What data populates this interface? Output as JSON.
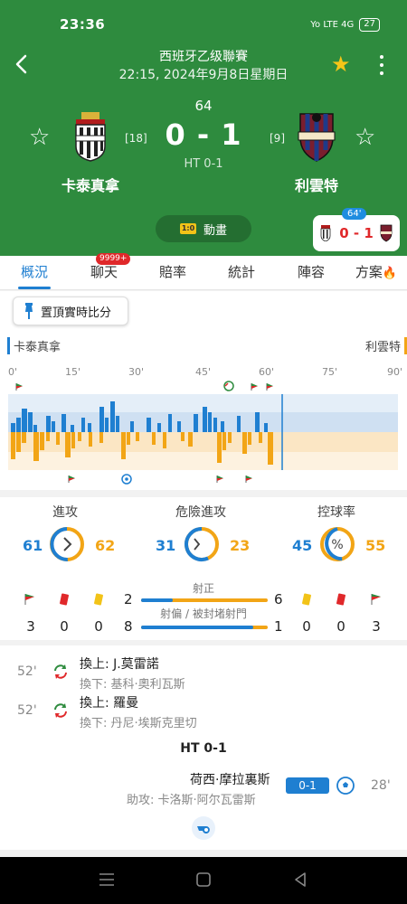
{
  "status_bar": {
    "time": "23:36",
    "network": "Yo LTE 4G",
    "battery": "27"
  },
  "header": {
    "league": "西班牙乙级聯賽",
    "datetime": "22:15, 2024年9月8日星期日",
    "minute": "64",
    "score": "0 - 1",
    "half_time": "HT 0-1",
    "home": {
      "name": "卡泰真拿",
      "rank": "[18]"
    },
    "away": {
      "name": "利雲特",
      "rank": "[9]"
    },
    "animation_label": "動畫",
    "animation_icon_text": "1:0",
    "mini_card": {
      "minute": "64'",
      "score": "0 - 1"
    },
    "colors": {
      "header_bg": "#2e8b3e",
      "star": "#f5c518"
    }
  },
  "tabs": [
    {
      "label": "概況",
      "active": true
    },
    {
      "label": "聊天",
      "badge": "9999+"
    },
    {
      "label": "賠率"
    },
    {
      "label": "統計"
    },
    {
      "label": "陣容"
    },
    {
      "label": "方案"
    }
  ],
  "pin_button": {
    "label": "置頂實時比分"
  },
  "momentum": {
    "home_label": "卡泰真拿",
    "away_label": "利雲特",
    "axis": [
      "0'",
      "15'",
      "30'",
      "45'",
      "60'",
      "75'",
      "90'"
    ]
  },
  "stats": {
    "attack": {
      "label": "進攻",
      "home": "61",
      "away": "62"
    },
    "danger": {
      "label": "危險進攻",
      "home": "31",
      "away": "23"
    },
    "possession": {
      "label": "控球率",
      "home": "45",
      "away": "55"
    },
    "shots_on_target": {
      "label": "射正",
      "home": "2",
      "away": "6"
    },
    "shots_off": {
      "label": "射偏 / 被封堵射門",
      "home": "8",
      "away": "1"
    },
    "home_cards": {
      "corners": "3",
      "red": "0",
      "yellow": "0"
    },
    "away_cards": {
      "yellow": "0",
      "red": "0",
      "corners": "3"
    }
  },
  "events": [
    {
      "minute": "52'",
      "in": "換上: J.莫雷諾",
      "out": "換下: 基科·奧利瓦斯"
    },
    {
      "minute": "52'",
      "in": "換上: 羅曼",
      "out": "換下: 丹尼·埃斯克里切"
    }
  ],
  "halftime_label": "HT 0-1",
  "goal": {
    "player": "荷西·摩拉裏斯",
    "assist": "助攻: 卡洛斯·阿尔瓦雷斯",
    "score": "0-1",
    "minute": "28'"
  }
}
